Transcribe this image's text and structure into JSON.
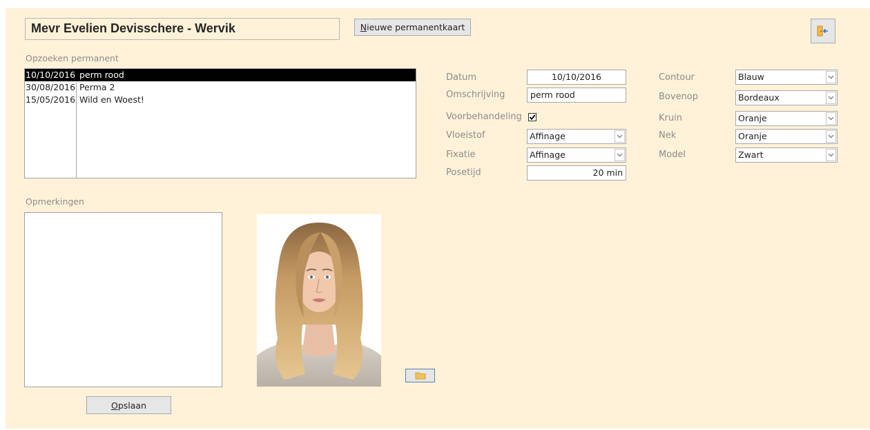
{
  "header": {
    "customer_title": "Mevr Evelien Devisschere - Wervik",
    "new_card_button": {
      "accel": "N",
      "rest": "ieuwe permanentkaart"
    },
    "exit_icon": "exit-door-icon"
  },
  "search": {
    "label": "Opzoeken permanent",
    "items": [
      {
        "date": "10/10/2016",
        "description": "perm rood",
        "selected": true
      },
      {
        "date": "30/08/2016",
        "description": "Perma 2",
        "selected": false
      },
      {
        "date": "15/05/2016",
        "description": "Wild en Woest!",
        "selected": false
      }
    ]
  },
  "details": {
    "datum": {
      "label": "Datum",
      "value": "10/10/2016"
    },
    "omschrijving": {
      "label": "Omschrijving",
      "value": "perm rood"
    },
    "voorbehandeling": {
      "label": "Voorbehandeling",
      "checked": true
    },
    "vloeistof": {
      "label": "Vloeistof",
      "value": "Affinage"
    },
    "fixatie": {
      "label": "Fixatie",
      "value": "Affinage"
    },
    "posetijd": {
      "label": "Posetijd",
      "value": "20 min"
    }
  },
  "colors": {
    "contour": {
      "label": "Contour",
      "value": "Blauw"
    },
    "bovenop": {
      "label": "Bovenop",
      "value": "Bordeaux"
    },
    "kruin": {
      "label": "Kruin",
      "value": "Oranje"
    },
    "nek": {
      "label": "Nek",
      "value": "Oranje"
    },
    "model": {
      "label": "Model",
      "value": "Zwart"
    }
  },
  "remarks": {
    "label": "Opmerkingen",
    "value": ""
  },
  "save_button": {
    "accel": "O",
    "rest": "pslaan"
  },
  "photo": {
    "browse_icon": "folder-icon"
  },
  "theme": {
    "background": "#fff2d9",
    "selected_row": "#000000"
  }
}
